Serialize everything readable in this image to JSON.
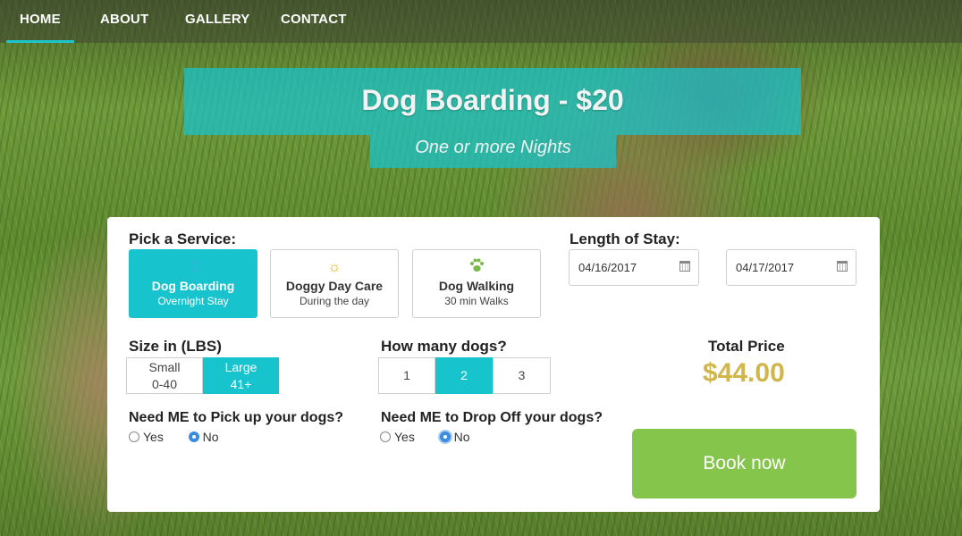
{
  "nav": {
    "items": [
      {
        "label": "HOME",
        "active": true
      },
      {
        "label": "ABOUT",
        "active": false
      },
      {
        "label": "GALLERY",
        "active": false
      },
      {
        "label": "CONTACT",
        "active": false
      }
    ]
  },
  "hero": {
    "title": "Dog Boarding - $20",
    "subtitle": "One or more Nights",
    "accent_color": "#17c4ce"
  },
  "service": {
    "label": "Pick a Service:",
    "options": [
      {
        "name": "Dog Boarding",
        "desc": "Overnight Stay",
        "icon": "moon-icon",
        "selected": true
      },
      {
        "name": "Doggy Day Care",
        "desc": "During the day",
        "icon": "sun-icon",
        "selected": false
      },
      {
        "name": "Dog Walking",
        "desc": "30 min Walks",
        "icon": "paw-icon",
        "selected": false
      }
    ]
  },
  "stay": {
    "label": "Length of Stay:",
    "start_date": "04/16/2017",
    "end_date": "04/17/2017"
  },
  "size": {
    "label": "Size in (LBS)",
    "options": [
      {
        "name": "Small",
        "range": "0-40",
        "selected": false
      },
      {
        "name": "Large",
        "range": "41+",
        "selected": true
      }
    ]
  },
  "dogs": {
    "label": "How many dogs?",
    "options": [
      "1",
      "2",
      "3"
    ],
    "selected": "2"
  },
  "total": {
    "label": "Total Price",
    "value": "$44.00",
    "color": "#d1b64b"
  },
  "pickup": {
    "label": "Need ME to Pick up your dogs?",
    "yes": "Yes",
    "no": "No",
    "selected": "No"
  },
  "dropoff": {
    "label": "Need ME to Drop Off your dogs?",
    "yes": "Yes",
    "no": "No",
    "selected": "No"
  },
  "book": {
    "label": "Book now",
    "color": "#86c54c"
  }
}
